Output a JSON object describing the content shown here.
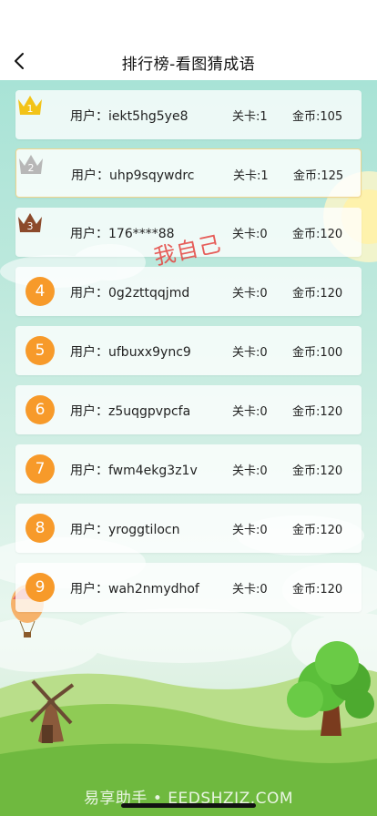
{
  "header": {
    "title": "排行榜-看图猜成语"
  },
  "stamp_text": "我自己",
  "user_label": "用户：",
  "level_label": "关卡:",
  "coin_label": "金币:",
  "rows": [
    {
      "rank": "1",
      "user": "iekt5hg5ye8",
      "level": "1",
      "coins": "105",
      "crown_color": "#f2c318"
    },
    {
      "rank": "2",
      "user": "uhp9sqywdrc",
      "level": "1",
      "coins": "125",
      "crown_color": "#b7b7b7"
    },
    {
      "rank": "3",
      "user": "176****88",
      "level": "0",
      "coins": "120",
      "crown_color": "#8c4a2b"
    },
    {
      "rank": "4",
      "user": "0g2zttqqjmd",
      "level": "0",
      "coins": "120"
    },
    {
      "rank": "5",
      "user": "ufbuxx9ync9",
      "level": "0",
      "coins": "100"
    },
    {
      "rank": "6",
      "user": "z5uqgpvpcfa",
      "level": "0",
      "coins": "120"
    },
    {
      "rank": "7",
      "user": "fwm4ekg3z1v",
      "level": "0",
      "coins": "120"
    },
    {
      "rank": "8",
      "user": "yroggtilocn",
      "level": "0",
      "coins": "120"
    },
    {
      "rank": "9",
      "user": "wah2nmydhof",
      "level": "0",
      "coins": "120"
    }
  ],
  "watermark": "易享助手 • EEDSHZJZ.COM",
  "colors": {
    "rank_circle": "#f79a2a",
    "highlight_border": "#f1d58d",
    "stamp": "#e5433f"
  }
}
